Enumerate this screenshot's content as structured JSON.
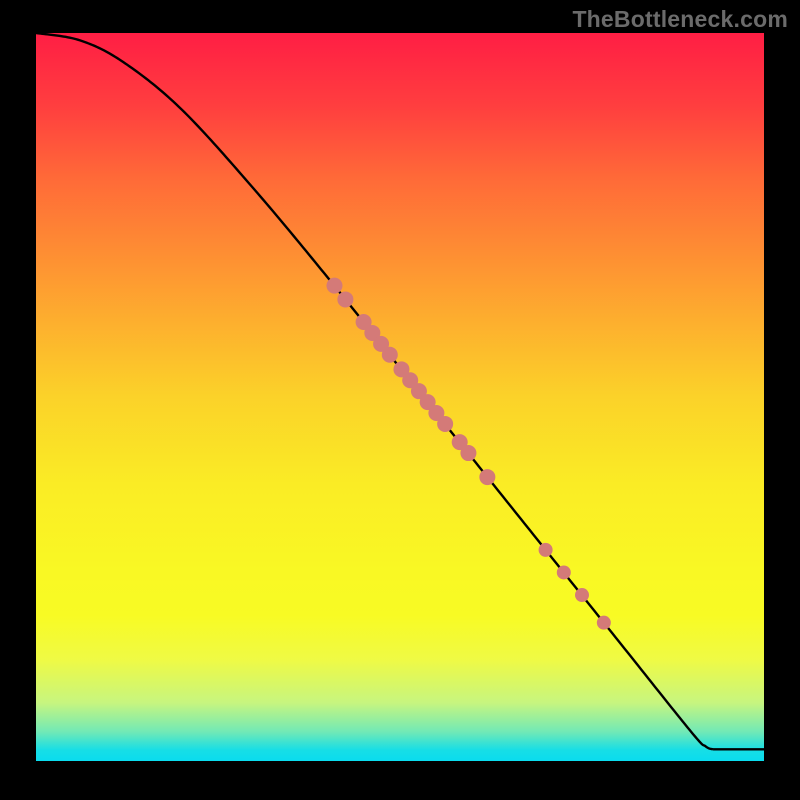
{
  "watermark": "TheBottleneck.com",
  "colors": {
    "dot": "#D47A78",
    "curve": "#000000"
  },
  "chart_data": {
    "type": "scatter",
    "title": "",
    "xlabel": "",
    "ylabel": "",
    "xlim": [
      0,
      100
    ],
    "ylim": [
      0,
      100
    ],
    "curve": {
      "description": "Monotone decreasing curve from top-left to bottom-right, with a final flat tail along the bottom.",
      "points": [
        {
          "x": 0,
          "y": 100
        },
        {
          "x": 6,
          "y": 99
        },
        {
          "x": 12,
          "y": 96
        },
        {
          "x": 20,
          "y": 89.5
        },
        {
          "x": 30,
          "y": 78.5
        },
        {
          "x": 40,
          "y": 66.5
        },
        {
          "x": 50,
          "y": 54
        },
        {
          "x": 60,
          "y": 41.5
        },
        {
          "x": 70,
          "y": 29
        },
        {
          "x": 80,
          "y": 16.5
        },
        {
          "x": 90,
          "y": 4
        },
        {
          "x": 92,
          "y": 2
        },
        {
          "x": 93,
          "y": 1.6
        },
        {
          "x": 100,
          "y": 1.6
        }
      ]
    },
    "series": [
      {
        "name": "cluster-upper",
        "r": 8,
        "points": [
          {
            "x": 41.0,
            "y": 65.3
          },
          {
            "x": 42.5,
            "y": 63.4
          },
          {
            "x": 45.0,
            "y": 60.3
          },
          {
            "x": 46.2,
            "y": 58.8
          },
          {
            "x": 47.4,
            "y": 57.3
          },
          {
            "x": 48.6,
            "y": 55.8
          },
          {
            "x": 50.2,
            "y": 53.8
          },
          {
            "x": 51.4,
            "y": 52.3
          },
          {
            "x": 52.6,
            "y": 50.8
          },
          {
            "x": 53.8,
            "y": 49.3
          },
          {
            "x": 55.0,
            "y": 47.8
          },
          {
            "x": 56.2,
            "y": 46.3
          },
          {
            "x": 58.2,
            "y": 43.8
          },
          {
            "x": 59.4,
            "y": 42.3
          },
          {
            "x": 62.0,
            "y": 39.0
          }
        ]
      },
      {
        "name": "cluster-lower",
        "r": 7,
        "points": [
          {
            "x": 70.0,
            "y": 29.0
          },
          {
            "x": 72.5,
            "y": 25.9
          },
          {
            "x": 75.0,
            "y": 22.8
          },
          {
            "x": 78.0,
            "y": 19.0
          }
        ]
      }
    ]
  }
}
